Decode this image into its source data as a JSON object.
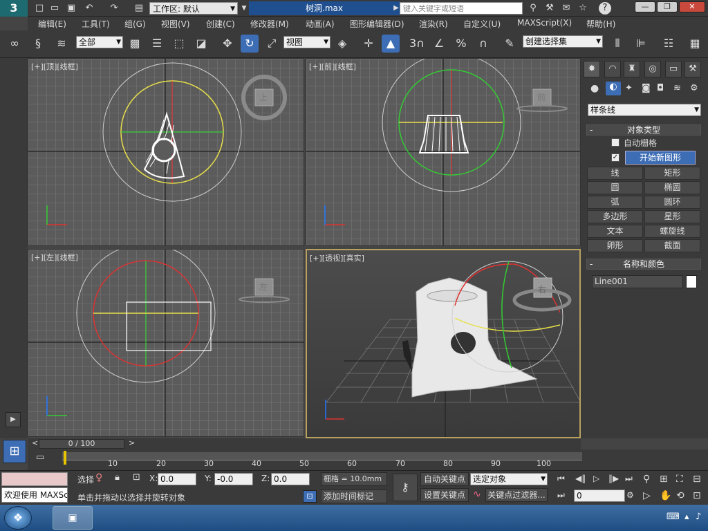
{
  "title_bar": {
    "workspace_label": "工作区: 默认",
    "file_name": "树洞.max",
    "search_placeholder": "键入关键字或短语"
  },
  "menu": [
    "编辑(E)",
    "工具(T)",
    "组(G)",
    "视图(V)",
    "创建(C)",
    "修改器(M)",
    "动画(A)",
    "图形编辑器(D)",
    "渲染(R)",
    "自定义(U)",
    "MAXScript(X)",
    "帮助(H)"
  ],
  "toolbar": {
    "selection_filter": "全部",
    "ref_coord": "视图",
    "named_selection": "创建选择集",
    "snap_3": "3",
    "snap_percent": "%"
  },
  "viewports": {
    "top_label": "[+][顶][线框]",
    "front_label": "[+][前][线框]",
    "left_label": "[+][左][线框]",
    "persp_label": "[+][透视][真实]",
    "viewcube_top": "上",
    "viewcube_front": "前",
    "viewcube_left": "左",
    "viewcube_persp": "右"
  },
  "command_panel": {
    "category_dropdown": "样条线",
    "object_type_header": "对象类型",
    "auto_grid": "自动栅格",
    "start_new_shape": "开始新图形",
    "buttons": [
      "线",
      "矩形",
      "圆",
      "椭圆",
      "弧",
      "圆环",
      "多边形",
      "星形",
      "文本",
      "螺旋线",
      "卵形",
      "截面"
    ],
    "name_color_header": "名称和颜色",
    "object_name": "Line001"
  },
  "timeline": {
    "frame_display": "0 / 100",
    "ticks": [
      "10",
      "20",
      "30",
      "40",
      "50",
      "60",
      "70",
      "80",
      "90",
      "100"
    ]
  },
  "status": {
    "maxscript_text": "欢迎使用 MAXSc",
    "select_label": "选择",
    "x_value": "0.0",
    "y_value": "-0.0",
    "z_value": "0.0",
    "grid_text": "栅格 = 10.0mm",
    "prompt": "单击并拖动以选择并旋转对象",
    "add_time_tag": "添加时间标记",
    "auto_key": "自动关键点",
    "set_key": "设置关键点",
    "key_target": "选定对象",
    "key_filters": "关键点过滤器...",
    "current_frame": "0"
  },
  "colors": {
    "accent": "#3d6db5",
    "panel_bg": "#3a3a3a",
    "viewport_bg": "#5b5b5b",
    "active_border": "#b9a15f"
  }
}
